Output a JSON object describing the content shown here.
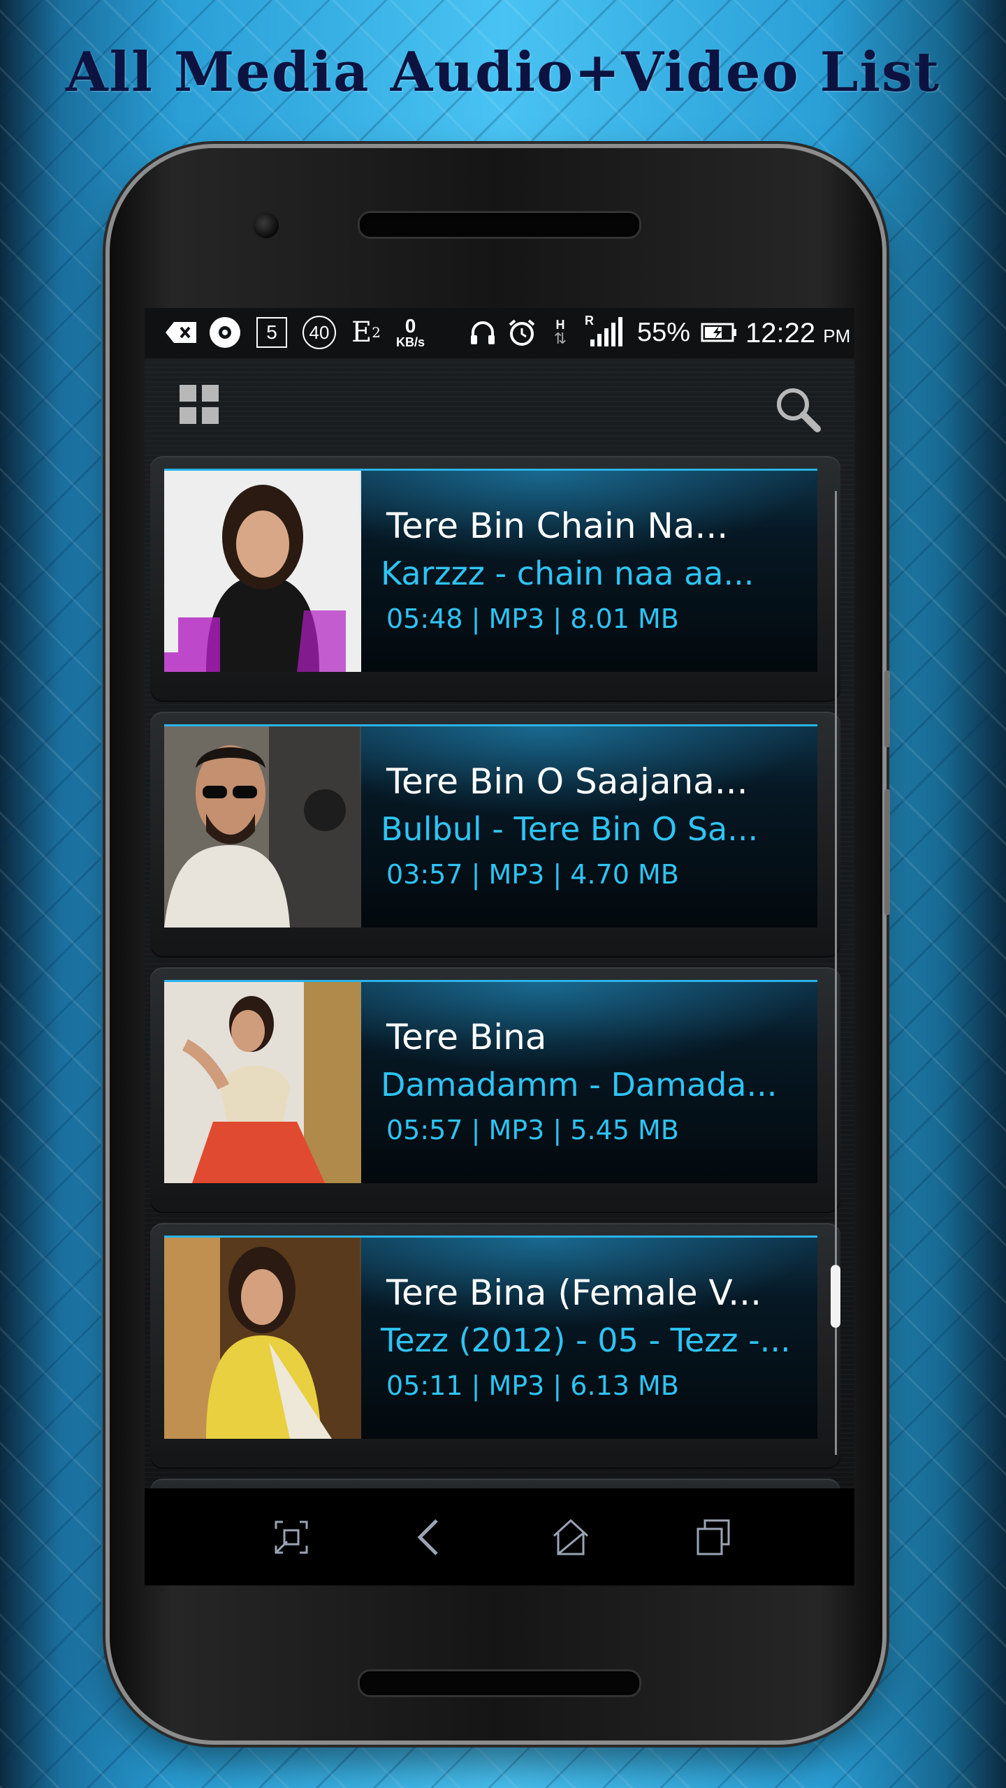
{
  "banner": {
    "title": "All Media Audio+Video List"
  },
  "statusbar": {
    "icons": [
      "delete-icon",
      "music-icon",
      "notification-5",
      "notification-40",
      "edge-icon",
      "data-speed-icon",
      "headphones-icon",
      "alarm-icon",
      "data-arrows-icon",
      "signal-icon",
      "battery-icon"
    ],
    "badge_box": "5",
    "badge_circle": "40",
    "network_type": "E",
    "network_sub": "2",
    "data_speed_value": "0",
    "data_speed_unit": "KB/s",
    "roaming_h": "H",
    "roaming_r": "R",
    "battery": "55%",
    "time": "12:22",
    "ampm": "PM"
  },
  "appbar": {
    "left_icon": "grid-icon",
    "right_icon": "search-icon"
  },
  "tracks": [
    {
      "title": "Tere Bin Chain Na...",
      "subtitle": "Karzzz - chain naa aa...",
      "meta": "05:48 | MP3 | 8.01 MB"
    },
    {
      "title": "Tere Bin O Saajana...",
      "subtitle": "Bulbul - Tere Bin O Sa...",
      "meta": "03:57 | MP3 | 4.70 MB"
    },
    {
      "title": "Tere Bina",
      "subtitle": "Damadamm - Damada...",
      "meta": "05:57 | MP3 | 5.45 MB"
    },
    {
      "title": "Tere Bina (Female V...",
      "subtitle": "Tezz (2012) - 05 - Tezz -...",
      "meta": "05:11 | MP3 | 6.13 MB"
    }
  ],
  "navbar": {
    "buttons": [
      "screenshot-icon",
      "back-icon",
      "home-icon",
      "recents-icon"
    ]
  },
  "colors": {
    "accent": "#2ec4f5",
    "title": "#0d1340"
  }
}
